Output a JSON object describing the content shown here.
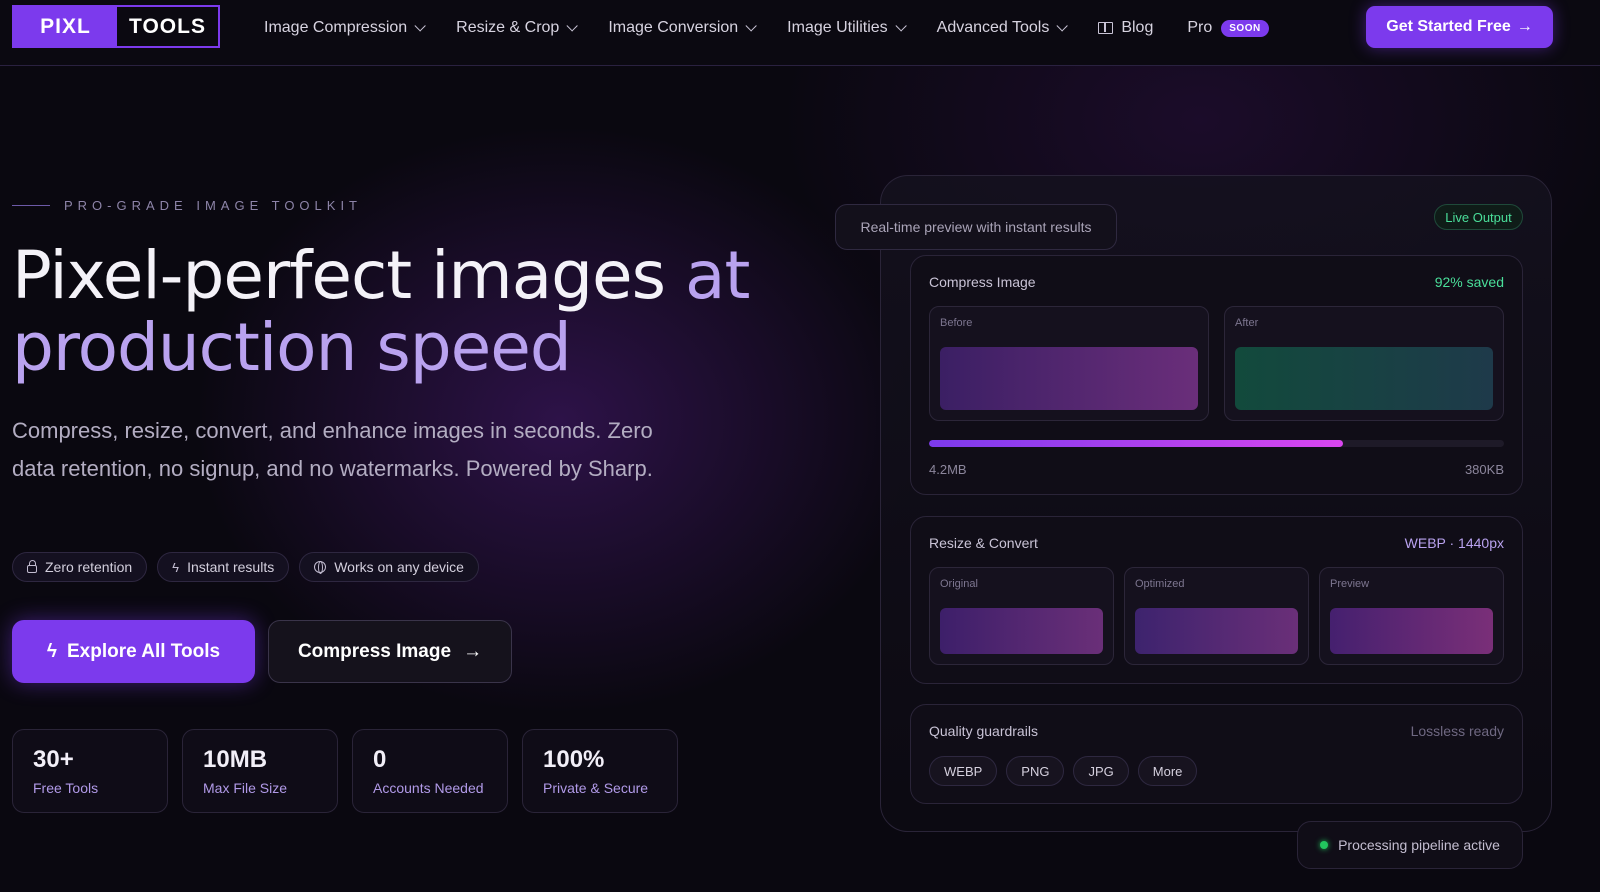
{
  "brand": {
    "part1": "PIXL",
    "part2": "TOOLS"
  },
  "nav": {
    "items": [
      {
        "label": "Image Compression",
        "dropdown": true
      },
      {
        "label": "Resize & Crop",
        "dropdown": true
      },
      {
        "label": "Image Conversion",
        "dropdown": true
      },
      {
        "label": "Image Utilities",
        "dropdown": true
      },
      {
        "label": "Advanced Tools",
        "dropdown": true
      }
    ],
    "blog": "Blog",
    "pro": "Pro",
    "pro_badge": "SOON",
    "cta": "Get Started Free",
    "cta_arrow": "→"
  },
  "hero": {
    "eyebrow": "PRO-GRADE IMAGE TOOLKIT",
    "headline_main": "Pixel-perfect images ",
    "headline_accent": "at production speed",
    "subtext": "Compress, resize, convert, and enhance images in seconds. Zero data retention, no signup, and no watermarks. Powered by Sharp.",
    "chips": [
      "Zero retention",
      "Instant results",
      "Works on any device"
    ],
    "primary_button": "Explore All Tools",
    "secondary_button": "Compress Image",
    "stats": [
      {
        "value": "30+",
        "label": "Free Tools"
      },
      {
        "value": "10MB",
        "label": "Max File Size"
      },
      {
        "value": "0",
        "label": "Accounts Needed"
      },
      {
        "value": "100%",
        "label": "Private & Secure"
      }
    ]
  },
  "preview": {
    "tip": "Real-time preview with instant results",
    "live_badge": "Live Output",
    "compress": {
      "title": "Compress Image",
      "saved": "92% saved",
      "before": "Before",
      "after": "After",
      "progress": 0.72,
      "size_from": "4.2MB",
      "size_to": "380KB"
    },
    "resize": {
      "title": "Resize & Convert",
      "meta": "WEBP · 1440px",
      "thumbs": [
        "Original",
        "Optimized",
        "Preview"
      ]
    },
    "quality": {
      "title": "Quality guardrails",
      "meta": "Lossless ready",
      "formats": [
        "WEBP",
        "PNG",
        "JPG",
        "More"
      ]
    },
    "pipeline": "Processing pipeline active"
  },
  "colors": {
    "accent": "#7c3aed",
    "accent_text": "#b9a2ef",
    "success": "#4ade9a",
    "background": "#0a0810"
  }
}
